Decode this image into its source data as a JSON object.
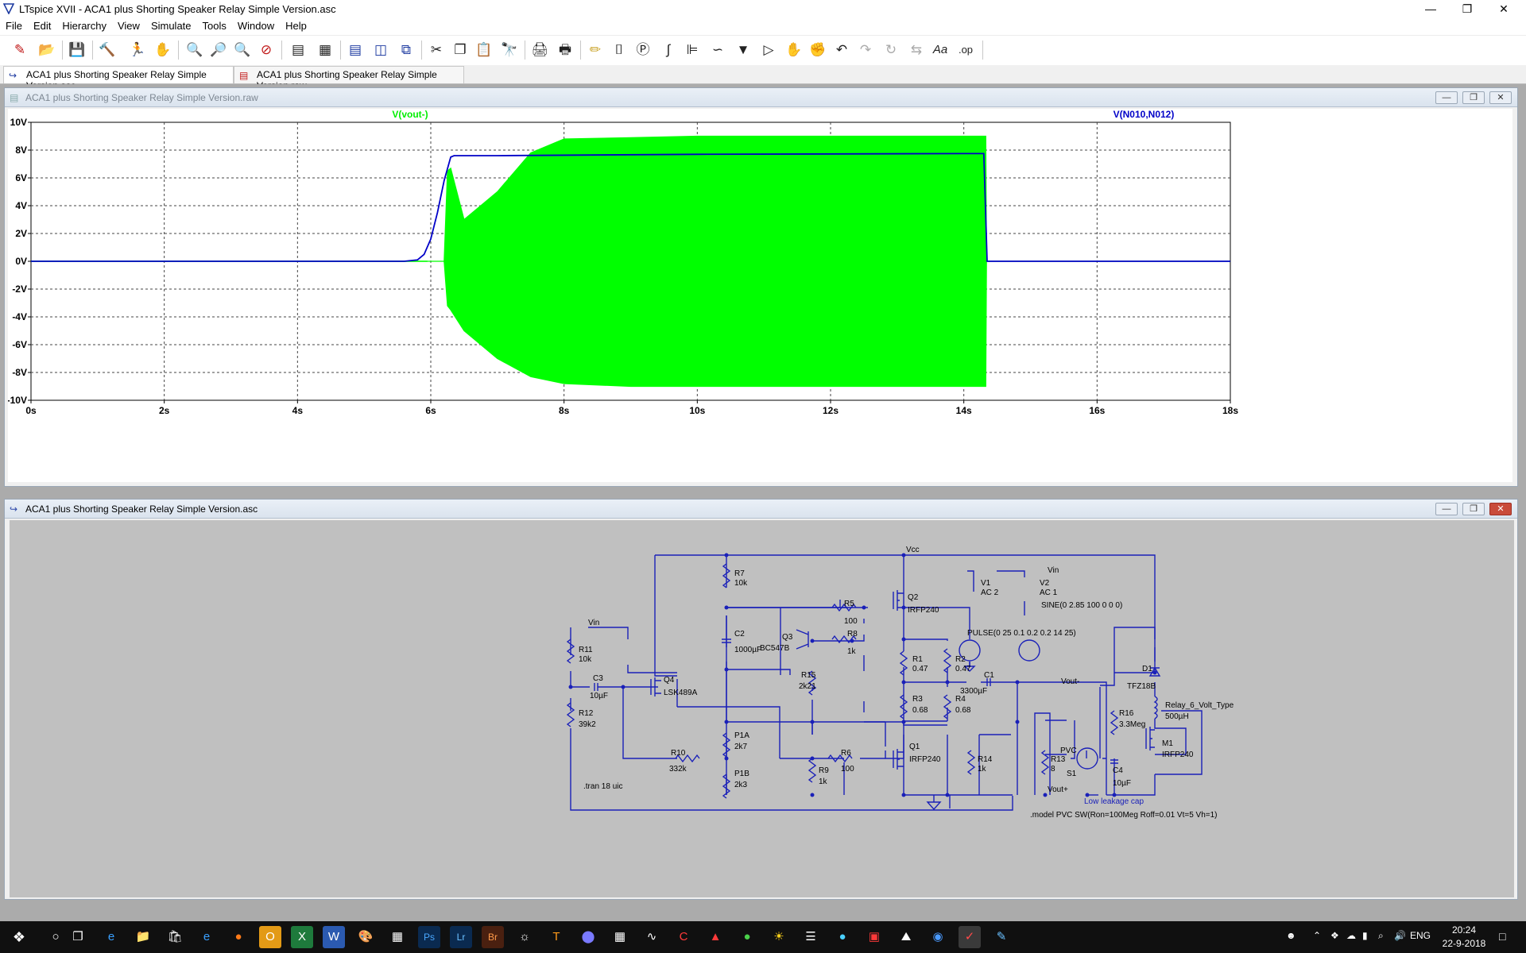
{
  "window": {
    "title": "LTspice XVII - ACA1 plus Shorting Speaker Relay Simple Version.asc",
    "controls": [
      "minimize",
      "maximize",
      "close"
    ]
  },
  "menu": [
    "File",
    "Edit",
    "Hierarchy",
    "View",
    "Simulate",
    "Tools",
    "Window",
    "Help"
  ],
  "toolbar_icons": [
    "new-schematic-icon",
    "open-icon",
    "save-icon",
    "control-panel-icon",
    "run-icon",
    "halt-icon",
    "zoom-in-icon",
    "zoom-area-icon",
    "zoom-out-icon",
    "zoom-fit-icon",
    "autorange-icon",
    "plot-settings-icon",
    "tile-horizontal-icon",
    "tile-vertical-icon",
    "cascade-icon",
    "cut-icon",
    "copy-icon",
    "paste-icon",
    "find-icon",
    "print-icon",
    "print-setup-icon",
    "draw-wire-icon",
    "ground-icon",
    "label-net-icon",
    "resistor-icon",
    "capacitor-icon",
    "inductor-icon",
    "diode-icon",
    "component-icon",
    "move-icon",
    "drag-icon",
    "undo-icon",
    "redo-icon",
    "rotate-icon",
    "mirror-icon",
    "text-icon",
    "spice-directive-icon"
  ],
  "doc_tabs": [
    {
      "label": "ACA1 plus Shorting Speaker Relay Simple Version.asc",
      "icon": "schematic-icon"
    },
    {
      "label": "ACA1 plus Shorting Speaker Relay Simple Version.raw",
      "icon": "waveform-icon"
    }
  ],
  "plot_window": {
    "title": "ACA1 plus Shorting Speaker Relay Simple Version.raw"
  },
  "schematic_window": {
    "title": "ACA1 plus Shorting Speaker Relay Simple Version.asc"
  },
  "chart_data": {
    "type": "line",
    "xlabel": "",
    "ylabel": "",
    "x_unit": "s",
    "y_unit": "V",
    "xlim": [
      0,
      18
    ],
    "ylim": [
      -10,
      10
    ],
    "x_ticks": [
      "0s",
      "2s",
      "4s",
      "6s",
      "8s",
      "10s",
      "12s",
      "14s",
      "16s",
      "18s"
    ],
    "y_ticks": [
      "10V",
      "8V",
      "6V",
      "4V",
      "2V",
      "0V",
      "-2V",
      "-4V",
      "-6V",
      "-8V",
      "-10V"
    ],
    "grid": true,
    "series": [
      {
        "name": "V(vout-)",
        "color": "#00ff00",
        "kind": "envelope",
        "x": [
          0,
          5.9,
          6.2,
          6.25,
          6.3,
          6.5,
          7.0,
          7.5,
          8.0,
          9.0,
          10.0,
          12.0,
          14.0,
          14.33,
          14.34,
          18
        ],
        "upper": [
          0,
          0,
          0,
          6.5,
          6.7,
          3.0,
          5.0,
          7.8,
          8.8,
          8.9,
          9.0,
          9.0,
          9.0,
          9.0,
          0,
          0
        ],
        "lower": [
          0,
          0,
          0,
          -3.2,
          -3.5,
          -5.0,
          -7.0,
          -8.3,
          -8.8,
          -9.0,
          -9.0,
          -9.0,
          -9.0,
          -9.0,
          0,
          0
        ]
      },
      {
        "name": "V(N010,N012)",
        "color": "#0000c8",
        "kind": "line",
        "x": [
          0,
          5.6,
          5.8,
          5.9,
          6.0,
          6.1,
          6.2,
          6.3,
          6.35,
          7.0,
          10.0,
          14.0,
          14.3,
          14.35,
          18
        ],
        "y": [
          0,
          0,
          0.1,
          0.5,
          1.6,
          3.5,
          5.8,
          7.5,
          7.6,
          7.6,
          7.7,
          7.75,
          7.75,
          0,
          0
        ]
      }
    ]
  },
  "schematic": {
    "labels": {
      "vcc": "Vcc",
      "vin_top": "Vin",
      "vin_left": "Vin",
      "vout_minus": "Vout-",
      "vout_plus": "Vout+",
      "tran": ".tran 18 uic",
      "model": ".model PVC SW(Ron=100Meg Roff=0.01 Vt=5 Vh=1)",
      "pulse": "PULSE(0 25 0.1 0.2 0.2 14 25)",
      "sine": "SINE(0 2.85 100 0 0 0)",
      "low_leakage": "Low leakage cap",
      "pvc": "PVC",
      "s1": "S1"
    },
    "components": [
      {
        "ref": "R7",
        "value": "10k"
      },
      {
        "ref": "R5",
        "value": "100"
      },
      {
        "ref": "Q2",
        "value": "IRFP240"
      },
      {
        "ref": "V1",
        "value": "AC 2"
      },
      {
        "ref": "V2",
        "value": "AC 1"
      },
      {
        "ref": "C2",
        "value": "1000µF"
      },
      {
        "ref": "Q3",
        "value": "BC547B"
      },
      {
        "ref": "R8",
        "value": "1k"
      },
      {
        "ref": "R1",
        "value": "0.47"
      },
      {
        "ref": "R2",
        "value": "0.47"
      },
      {
        "ref": "R11",
        "value": "10k"
      },
      {
        "ref": "C3",
        "value": "10µF"
      },
      {
        "ref": "Q4",
        "value": "LSK489A"
      },
      {
        "ref": "R15",
        "value": "2k21"
      },
      {
        "ref": "C1",
        "value": "3300µF"
      },
      {
        "ref": "R3",
        "value": "0.68"
      },
      {
        "ref": "R4",
        "value": "0.68"
      },
      {
        "ref": "R12",
        "value": "39k2"
      },
      {
        "ref": "P1A",
        "value": "2k7"
      },
      {
        "ref": "R10",
        "value": "332k"
      },
      {
        "ref": "R9",
        "value": "1k"
      },
      {
        "ref": "R6",
        "value": "100"
      },
      {
        "ref": "Q1",
        "value": "IRFP240"
      },
      {
        "ref": "R14",
        "value": "1k"
      },
      {
        "ref": "R13",
        "value": "8"
      },
      {
        "ref": "P1B",
        "value": "2k3"
      },
      {
        "ref": "D1",
        "value": "TFZ18B"
      },
      {
        "ref": "R16",
        "value": "3.3Meg"
      },
      {
        "ref": "Relay_6_Volt_Type",
        "value": "500µH"
      },
      {
        "ref": "M1",
        "value": "IRFP240"
      },
      {
        "ref": "C4",
        "value": "10µF"
      }
    ]
  },
  "taskbar": {
    "apps": [
      "start-icon",
      "cortana-icon",
      "task-view-icon",
      "edge-icon",
      "file-explorer-icon",
      "store-icon",
      "internet-explorer-icon",
      "firefox-icon",
      "outlook-icon",
      "excel-icon",
      "word-icon",
      "paint-icon",
      "calculator-icon",
      "photoshop-icon",
      "lightroom-icon",
      "bridge-icon",
      "compass-icon",
      "t-app-icon",
      "egg-app-icon",
      "grid-app-icon",
      "waveform-app-icon",
      "c-app-icon",
      "red-app-icon",
      "green-app-icon",
      "sun-app-icon",
      "slider-app-icon",
      "ball-app-icon",
      "pdf-app-icon",
      "photo-app-icon",
      "chrome-icon",
      "ltspice-icon",
      "notes-app-icon"
    ],
    "tray_lang": "ENG",
    "time": "20:24",
    "date": "22-9-2018"
  }
}
